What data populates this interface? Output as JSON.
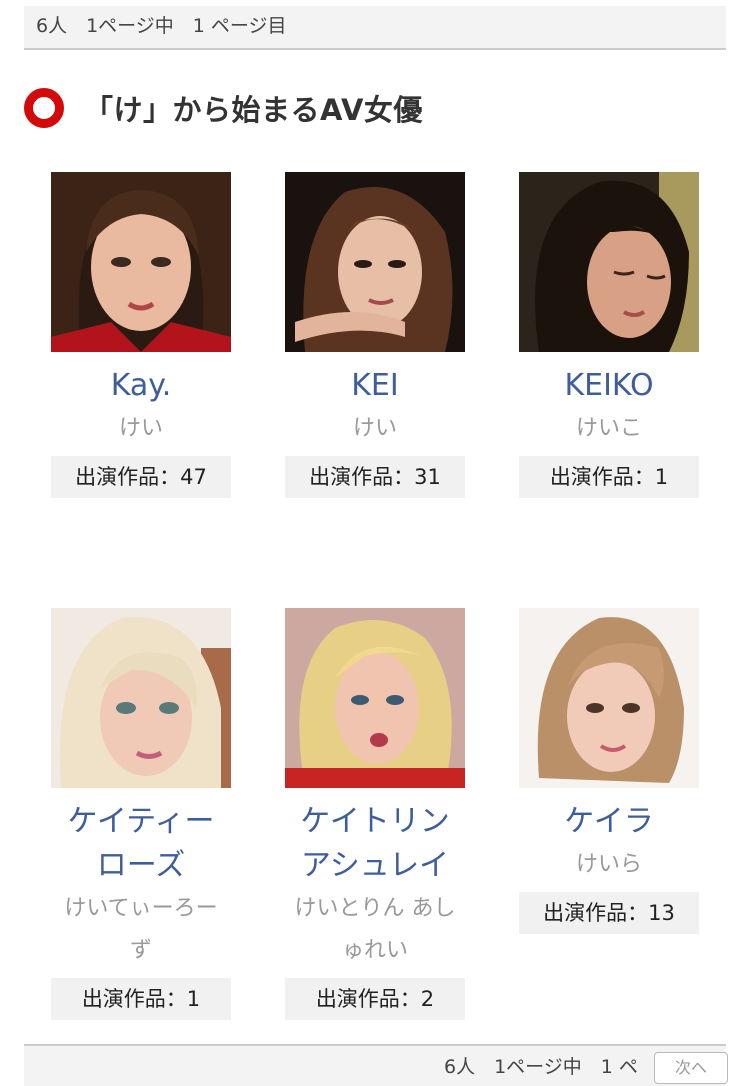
{
  "pager": {
    "top_text": "6人　1ページ中　1 ページ目",
    "bottom_text": "6人　1ページ中　1 ペ",
    "next_label": "次へ"
  },
  "section": {
    "title": "「け」から始まるAV女優",
    "icon": "red-ring-icon",
    "accent_color": "#d20a0a"
  },
  "actresses": [
    {
      "name": "Kay.",
      "kana": "けい",
      "count_label": "出演作品：47"
    },
    {
      "name": "KEI",
      "kana": "けい",
      "count_label": "出演作品：31"
    },
    {
      "name": "KEIKO",
      "kana": "けいこ",
      "count_label": "出演作品：1"
    },
    {
      "name": "ケイティー\nローズ",
      "kana": "けいてぃーろー\nず",
      "count_label": "出演作品：1"
    },
    {
      "name": "ケイトリン\nアシュレイ",
      "kana": "けいとりん あし\nゅれい",
      "count_label": "出演作品：2"
    },
    {
      "name": "ケイラ",
      "kana": "けいら",
      "count_label": "出演作品：13"
    }
  ],
  "colors": {
    "link": "#3e5e9b",
    "kana": "#999999",
    "count_bg": "#f1f1f1"
  }
}
